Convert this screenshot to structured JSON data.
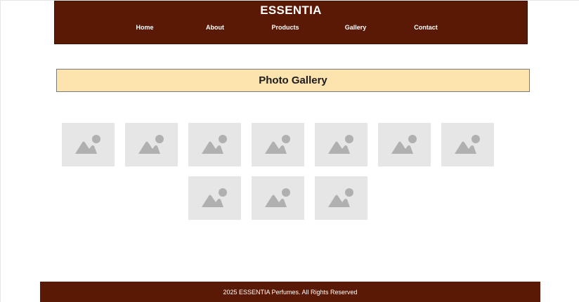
{
  "header": {
    "brand": "ESSENTIA",
    "nav": [
      {
        "label": "Home"
      },
      {
        "label": "About"
      },
      {
        "label": "Products"
      },
      {
        "label": "Gallery"
      },
      {
        "label": "Contact"
      }
    ],
    "background_color": "#5a1904"
  },
  "gallery": {
    "title": "Photo Gallery",
    "banner_color": "#fde3ae",
    "placeholder_icon": "image-placeholder-icon",
    "images": [
      {
        "icon": "image-placeholder-icon"
      },
      {
        "icon": "image-placeholder-icon"
      },
      {
        "icon": "image-placeholder-icon"
      },
      {
        "icon": "image-placeholder-icon"
      },
      {
        "icon": "image-placeholder-icon"
      },
      {
        "icon": "image-placeholder-icon"
      },
      {
        "icon": "image-placeholder-icon"
      },
      {
        "icon": "image-placeholder-icon"
      },
      {
        "icon": "image-placeholder-icon"
      },
      {
        "icon": "image-placeholder-icon"
      }
    ]
  },
  "footer": {
    "text": "2025 ESSENTIA Perfumes. All Rights Reserved",
    "background_color": "#5a1904"
  }
}
